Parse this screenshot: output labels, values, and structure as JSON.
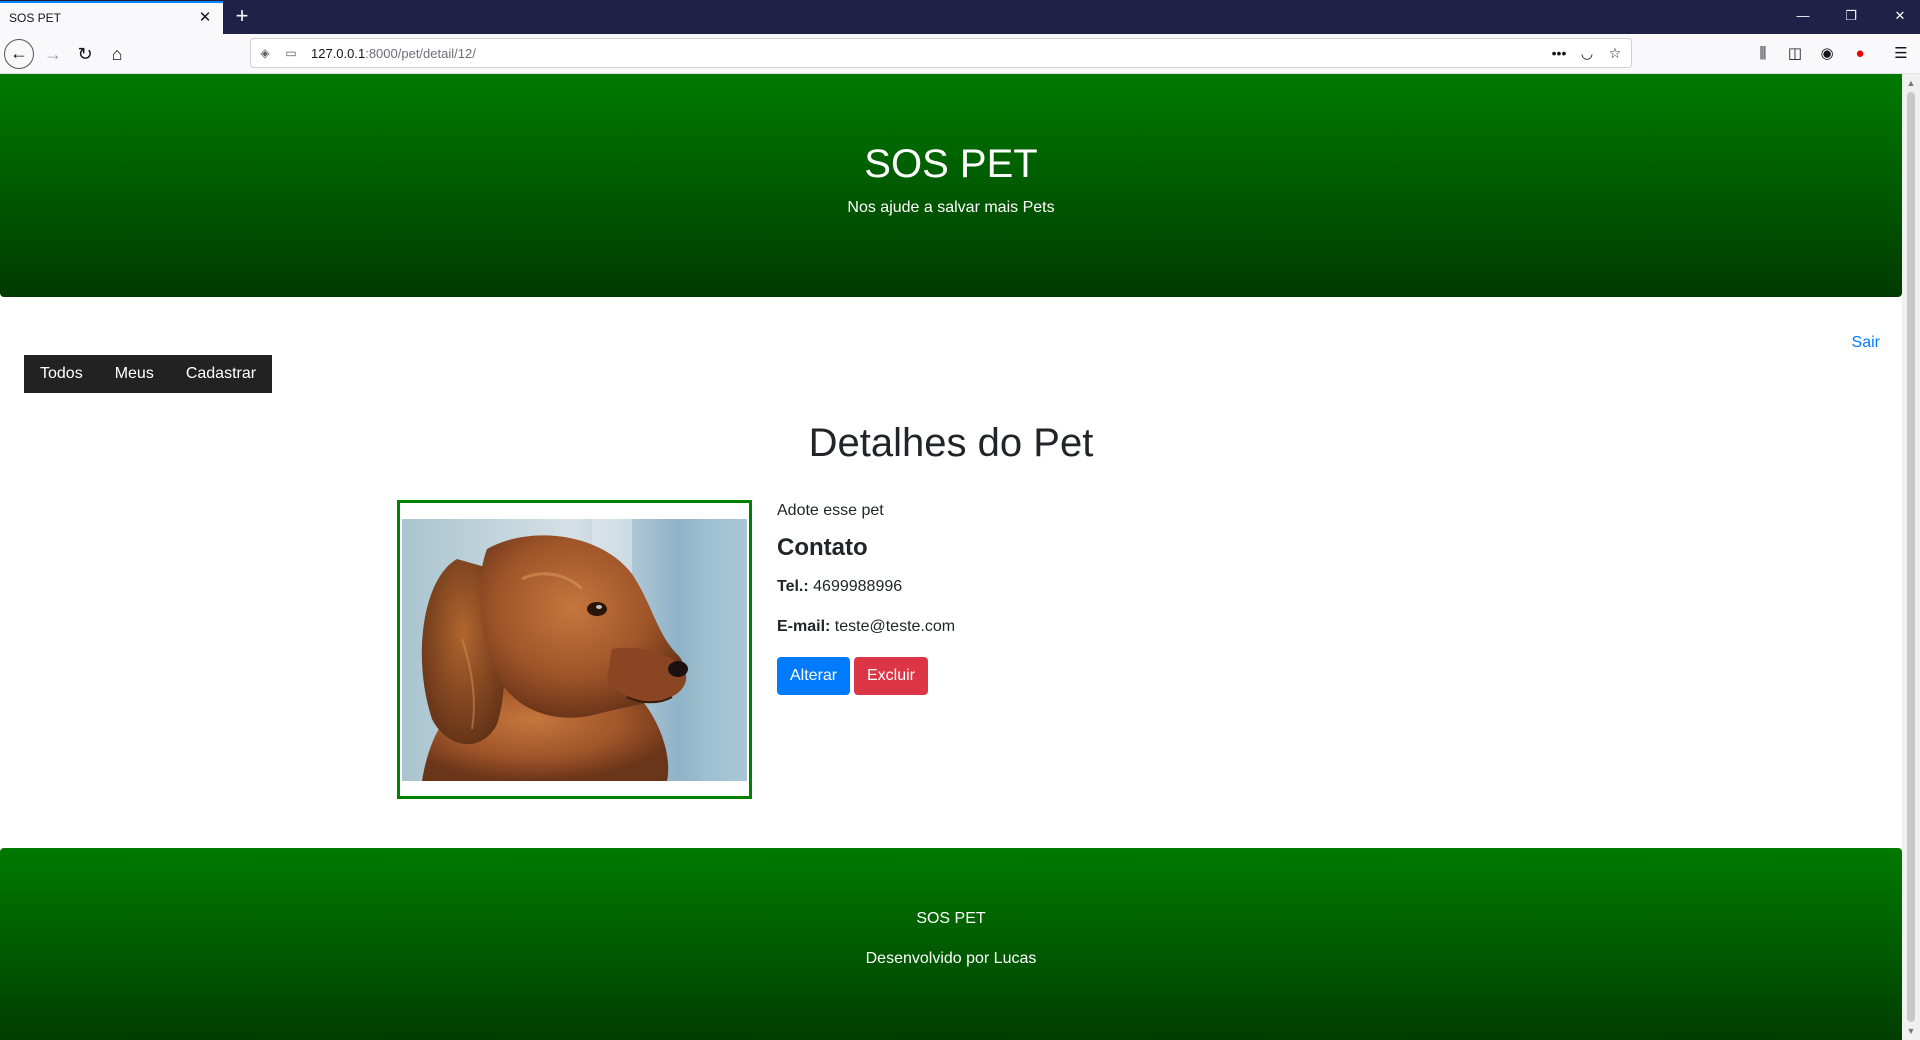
{
  "browser": {
    "tab_title": "SOS PET",
    "tab_close": "✕",
    "new_tab": "+",
    "url_host": "127.0.0.1",
    "url_path": ":8000/pet/detail/12/",
    "window_controls": {
      "minimize": "—",
      "restore": "❐",
      "close": "✕"
    }
  },
  "header": {
    "title": "SOS PET",
    "subtitle": "Nos ajude a salvar mais Pets"
  },
  "logout_label": "Sair",
  "menu": {
    "items": [
      {
        "label": "Todos"
      },
      {
        "label": "Meus"
      },
      {
        "label": "Cadastrar"
      }
    ]
  },
  "detail": {
    "title": "Detalhes do Pet",
    "description": "Adote esse pet",
    "contact_heading": "Contato",
    "phone_label": "Tel.:",
    "phone_value": "4699988996",
    "email_label": "E-mail:",
    "email_value": "teste@teste.com",
    "edit_button": "Alterar",
    "delete_button": "Excluir"
  },
  "footer": {
    "name": "SOS PET",
    "credit": "Desenvolvido por Lucas"
  },
  "colors": {
    "header_green": "#007a00",
    "header_dark_green": "#003a00",
    "primary": "#007bff",
    "danger": "#dc3545",
    "menu_bg": "#222222"
  }
}
